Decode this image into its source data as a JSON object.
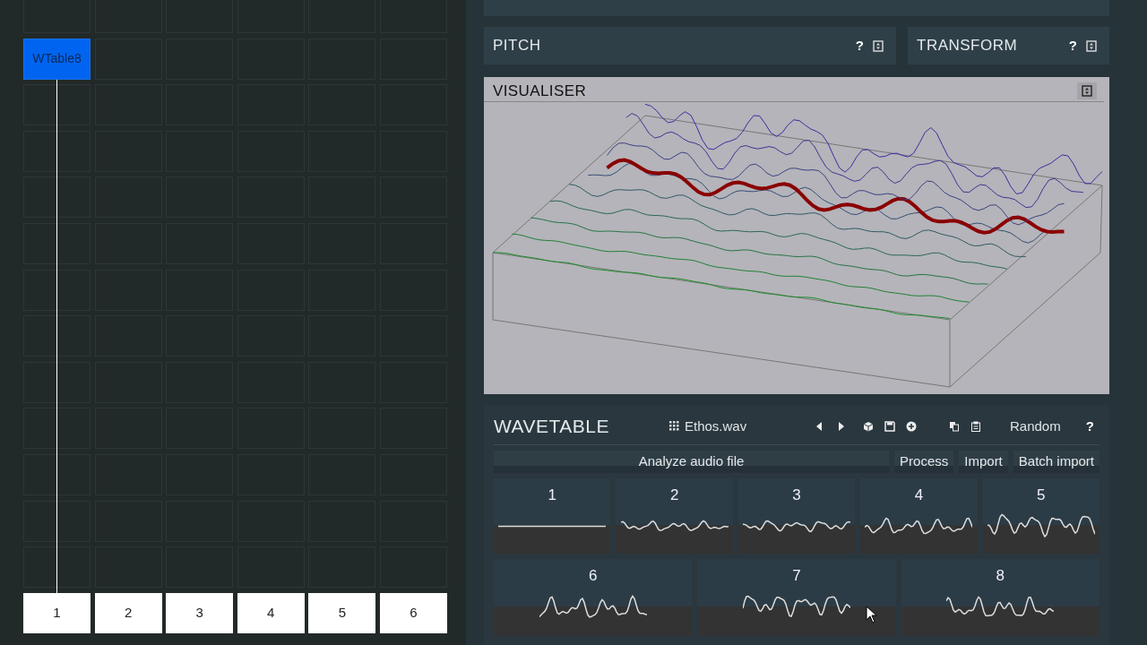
{
  "sequencer": {
    "rows": [
      [
        null,
        null,
        null,
        null,
        null,
        null
      ],
      [
        {
          "label": "WTable8",
          "selected": true
        },
        null,
        null,
        null,
        null,
        null
      ],
      [
        null,
        null,
        null,
        null,
        null,
        null
      ],
      [
        null,
        null,
        null,
        null,
        null,
        null
      ],
      [
        null,
        null,
        null,
        null,
        null,
        null
      ],
      [
        null,
        null,
        null,
        null,
        null,
        null
      ],
      [
        null,
        null,
        null,
        null,
        null,
        null
      ],
      [
        null,
        null,
        null,
        null,
        null,
        null
      ],
      [
        null,
        null,
        null,
        null,
        null,
        null
      ],
      [
        null,
        null,
        null,
        null,
        null,
        null
      ],
      [
        null,
        null,
        null,
        null,
        null,
        null
      ],
      [
        null,
        null,
        null,
        null,
        null,
        null
      ],
      [
        null,
        null,
        null,
        null,
        null,
        null
      ]
    ]
  },
  "track_buttons": [
    {
      "label": "1"
    },
    {
      "label": "2"
    },
    {
      "label": "3"
    },
    {
      "label": "4"
    },
    {
      "label": "5"
    },
    {
      "label": "6"
    }
  ],
  "panels": [
    {
      "title": "PITCH",
      "help": "?"
    },
    {
      "title": "TRANSFORM",
      "help": "?"
    }
  ],
  "visualiser": {
    "title": "VISUALISER"
  },
  "wavetable": {
    "title": "WAVETABLE",
    "file": "Ethos.wav",
    "preset_button": "Random",
    "help": "?",
    "actions": [
      {
        "label": "Analyze audio file",
        "kind": "wide"
      },
      {
        "label": "Process",
        "kind": "small"
      },
      {
        "label": "Import",
        "kind": "small"
      },
      {
        "label": "Batch import",
        "kind": "small"
      }
    ],
    "slots": [
      {
        "label": "1"
      },
      {
        "label": "2"
      },
      {
        "label": "3"
      },
      {
        "label": "4"
      },
      {
        "label": "5"
      },
      {
        "label": "6"
      },
      {
        "label": "7"
      },
      {
        "label": "8"
      }
    ]
  }
}
